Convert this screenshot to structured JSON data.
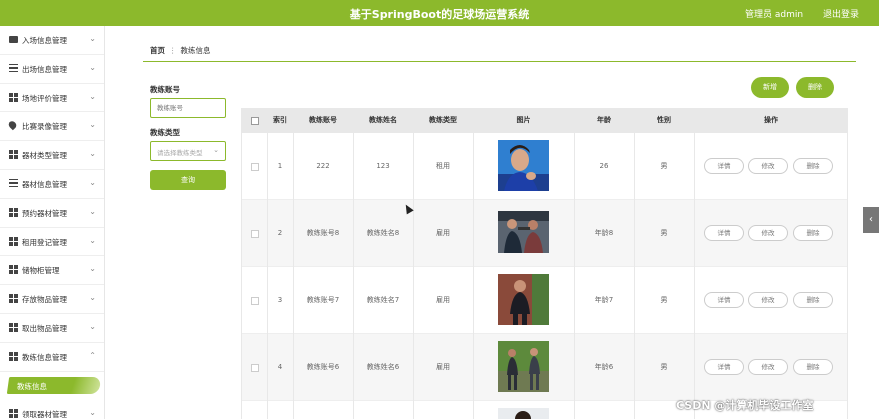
{
  "header": {
    "title": "基于SpringBoot的足球场运营系统",
    "user": "管理员 admin",
    "logout": "退出登录",
    "accent": "#8cb92c"
  },
  "sidebar": {
    "items": [
      {
        "label": "入场信息管理",
        "icon": "briefcase-icon"
      },
      {
        "label": "出场信息管理",
        "icon": "list-icon"
      },
      {
        "label": "场地评价管理",
        "icon": "grid-icon"
      },
      {
        "label": "比赛录像管理",
        "icon": "pin-icon"
      },
      {
        "label": "器材类型管理",
        "icon": "grid-icon"
      },
      {
        "label": "器材信息管理",
        "icon": "sliders-icon"
      },
      {
        "label": "预约器材管理",
        "icon": "grid-icon"
      },
      {
        "label": "租用登记管理",
        "icon": "grid-icon"
      },
      {
        "label": "储物柜管理",
        "icon": "grid-icon"
      },
      {
        "label": "存放物品管理",
        "icon": "grid-icon"
      },
      {
        "label": "取出物品管理",
        "icon": "grid-icon"
      },
      {
        "label": "教练信息管理",
        "icon": "grid-icon"
      }
    ],
    "active_sub": "教练信息",
    "last_item": {
      "label": "领取器材管理",
      "icon": "grid-icon"
    }
  },
  "breadcrumb": {
    "home": "首页",
    "current": "教练信息"
  },
  "search": {
    "account_label": "教练账号",
    "account_placeholder": "教练账号",
    "type_label": "教练类型",
    "type_placeholder": "请选择教练类型",
    "query_button": "查询"
  },
  "actions": {
    "add": "新增",
    "delete": "删除"
  },
  "table": {
    "headers": [
      "索引",
      "教练账号",
      "教练姓名",
      "教练类型",
      "图片",
      "年龄",
      "性别",
      "操作"
    ],
    "rows": [
      {
        "index": "1",
        "account": "222",
        "name": "123",
        "type": "租用",
        "age": "26",
        "gender": "男"
      },
      {
        "index": "2",
        "account": "教练账号8",
        "name": "教练姓名8",
        "type": "雇用",
        "age": "年龄8",
        "gender": "男"
      },
      {
        "index": "3",
        "account": "教练账号7",
        "name": "教练姓名7",
        "type": "雇用",
        "age": "年龄7",
        "gender": "男"
      },
      {
        "index": "4",
        "account": "教练账号6",
        "name": "教练姓名6",
        "type": "雇用",
        "age": "年龄6",
        "gender": "男"
      }
    ],
    "row_actions": {
      "detail": "详情",
      "edit": "修改",
      "delete": "删除"
    }
  },
  "watermark": "CSDN @计算机毕设工作室"
}
